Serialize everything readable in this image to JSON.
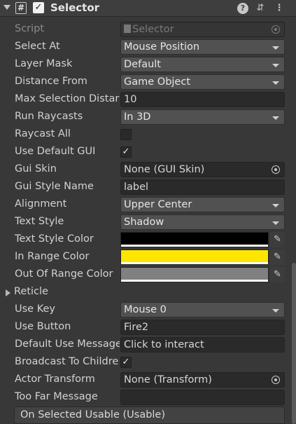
{
  "header": {
    "script_icon": "#",
    "enabled_mark": "✓",
    "title": "Selector",
    "help_icon_glyph": "?",
    "preset_icon_glyph": "⇵",
    "menu_icon_glyph": "⋮"
  },
  "fields": {
    "script": {
      "label": "Script",
      "value": "Selector"
    },
    "select_at": {
      "label": "Select At",
      "value": "Mouse Position"
    },
    "layer_mask": {
      "label": "Layer Mask",
      "value": "Default"
    },
    "distance_from": {
      "label": "Distance From",
      "value": "Game Object"
    },
    "max_selection_distance": {
      "label": "Max Selection Distar",
      "value": "10"
    },
    "run_raycasts": {
      "label": "Run Raycasts",
      "value": "In 3D"
    },
    "raycast_all": {
      "label": "Raycast All",
      "checked": false,
      "mark": ""
    },
    "use_default_gui": {
      "label": "Use Default GUI",
      "checked": true,
      "mark": "✓"
    },
    "gui_skin": {
      "label": "Gui Skin",
      "value": "None (GUI Skin)"
    },
    "gui_style_name": {
      "label": "Gui Style Name",
      "value": "label"
    },
    "alignment": {
      "label": "Alignment",
      "value": "Upper Center"
    },
    "text_style": {
      "label": "Text Style",
      "value": "Shadow"
    },
    "text_style_color": {
      "label": "Text Style Color",
      "color": "#000000"
    },
    "in_range_color": {
      "label": "In Range Color",
      "color": "#ffe600"
    },
    "out_of_range_color": {
      "label": "Out Of Range Color",
      "color": "#808080"
    },
    "reticle": {
      "label": "Reticle"
    },
    "use_key": {
      "label": "Use Key",
      "value": "Mouse 0"
    },
    "use_button": {
      "label": "Use Button",
      "value": "Fire2"
    },
    "default_use_message": {
      "label": "Default Use Message",
      "value": "Click to interact"
    },
    "broadcast_to_children": {
      "label": "Broadcast To Childre",
      "checked": true,
      "mark": "✓"
    },
    "actor_transform": {
      "label": "Actor Transform",
      "value": "None (Transform)"
    },
    "too_far_message": {
      "label": "Too Far Message",
      "value": ""
    }
  },
  "event": {
    "label": "On Selected Usable (Usable)"
  },
  "icons": {
    "picker": "✎"
  }
}
